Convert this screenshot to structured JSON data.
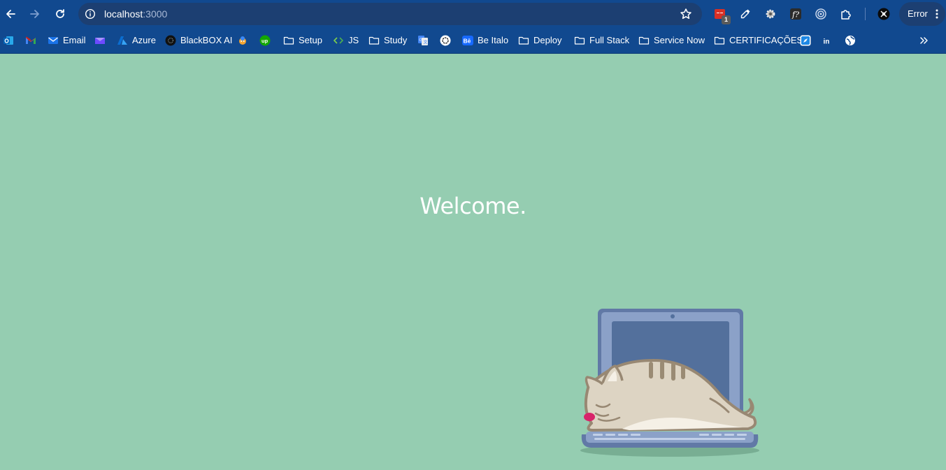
{
  "browser": {
    "address": {
      "host": "localhost",
      "port": ":3000"
    },
    "extension_badge": "1",
    "profile_label": "Error"
  },
  "bookmarks": [
    {
      "label": "",
      "icon": "outlook-icon"
    },
    {
      "label": "",
      "icon": "gmail-icon"
    },
    {
      "label": "Email",
      "icon": "mail-icon"
    },
    {
      "label": "",
      "icon": "proton-mail-icon"
    },
    {
      "label": "Azure",
      "icon": "azure-icon"
    },
    {
      "label": "BlackBOX AI",
      "icon": "blackbox-icon"
    },
    {
      "label": "",
      "icon": "extension-mascot-icon"
    },
    {
      "label": "",
      "icon": "upwork-icon"
    },
    {
      "label": "Setup",
      "icon": "folder-icon"
    },
    {
      "label": "JS",
      "icon": "code-icon"
    },
    {
      "label": "Study",
      "icon": "folder-icon"
    },
    {
      "label": "",
      "icon": "google-translate-icon"
    },
    {
      "label": "",
      "icon": "openai-icon"
    },
    {
      "label": "Be Italo",
      "icon": "behance-icon"
    },
    {
      "label": "Deploy",
      "icon": "folder-icon"
    },
    {
      "label": "Full Stack",
      "icon": "folder-icon"
    },
    {
      "label": "Service Now",
      "icon": "folder-icon"
    },
    {
      "label": "CERTIFICAÇÕES",
      "icon": "folder-icon"
    },
    {
      "label": "",
      "icon": "compass-icon"
    },
    {
      "label": "",
      "icon": "linkedin-icon"
    },
    {
      "label": "",
      "icon": "globe-icon"
    }
  ],
  "page": {
    "heading": "Welcome.",
    "background": "#95cdb1"
  },
  "colors": {
    "chrome": "#11498f",
    "omnibox": "#1c3f72"
  }
}
